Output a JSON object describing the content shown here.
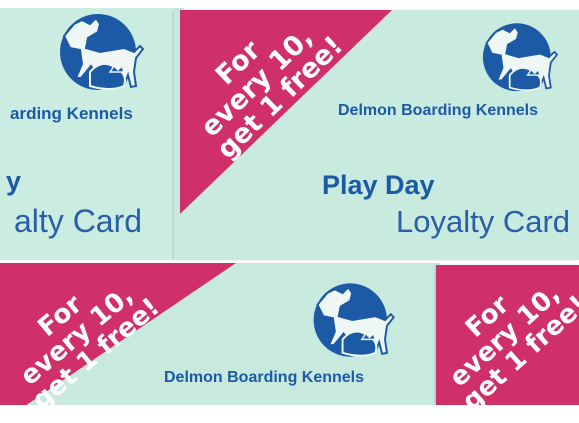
{
  "brand": {
    "name": "Delmon Boarding Kennels",
    "partial_name": "arding Kennels"
  },
  "promo": {
    "line1": "For",
    "line2": "every 10,",
    "line3": "get 1 free!"
  },
  "card": {
    "title": "Play Day",
    "subtitle": "Loyalty Card",
    "partial_title": "y",
    "partial_subtitle": "alty Card"
  },
  "colors": {
    "card_bg": "#c9ece0",
    "promo_pink": "#d0306a",
    "brand_blue": "#1d5aa6"
  },
  "icons": {
    "logo": "dog-and-cat-logo-icon"
  }
}
